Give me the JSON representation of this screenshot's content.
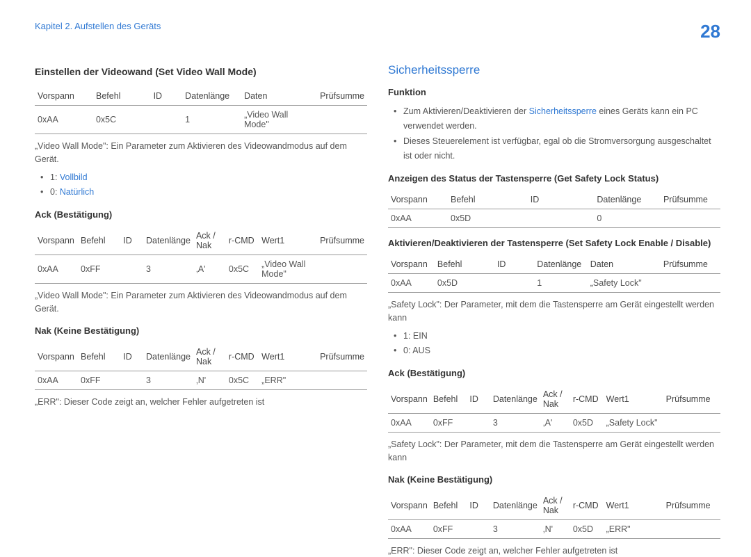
{
  "header": {
    "chapter": "Kapitel 2. Aufstellen des Geräts",
    "page_number": "28"
  },
  "left": {
    "h1": "Einstellen der Videowand (Set Video Wall Mode)",
    "table1": {
      "headers": [
        "Vorspann",
        "Befehl",
        "ID",
        "Datenlänge",
        "Daten",
        "Prüfsumme"
      ],
      "row": [
        "0xAA",
        "0x5C",
        "",
        "1",
        "„Video Wall Mode\"",
        ""
      ]
    },
    "note1": "„Video Wall Mode\": Ein Parameter zum Aktivieren des Videowandmodus auf dem Gerät.",
    "bullet1_prefix": "1: ",
    "bullet1_link": "Vollbild",
    "bullet2_prefix": "0: ",
    "bullet2_link": "Natürlich",
    "h2": "Ack (Bestätigung)",
    "table2": {
      "headers": [
        "Vorspann",
        "Befehl",
        "ID",
        "Datenlänge",
        "Ack / Nak",
        "r-CMD",
        "Wert1",
        "Prüfsumme"
      ],
      "row": [
        "0xAA",
        "0xFF",
        "",
        "3",
        "‚A'",
        "0x5C",
        "„Video Wall Mode\"",
        ""
      ]
    },
    "note2": "„Video Wall Mode\": Ein Parameter zum Aktivieren des Videowandmodus auf dem Gerät.",
    "h3": "Nak (Keine Bestätigung)",
    "table3": {
      "headers": [
        "Vorspann",
        "Befehl",
        "ID",
        "Datenlänge",
        "Ack / Nak",
        "r-CMD",
        "Wert1",
        "Prüfsumme"
      ],
      "row": [
        "0xAA",
        "0xFF",
        "",
        "3",
        "‚N'",
        "0x5C",
        "„ERR\"",
        ""
      ]
    },
    "note3": "„ERR\": Dieser Code zeigt an, welcher Fehler aufgetreten ist"
  },
  "right": {
    "main_heading": "Sicherheitssperre",
    "h1": "Funktion",
    "bullet1a": "Zum Aktivieren/Deaktivieren der ",
    "bullet1b_link": "Sicherheitssperre",
    "bullet1c": " eines Geräts kann ein PC verwendet werden.",
    "bullet2": "Dieses Steuerelement ist verfügbar, egal ob die Stromversorgung ausgeschaltet ist oder nicht.",
    "h2": "Anzeigen des Status der Tastensperre (Get Safety Lock Status)",
    "table1": {
      "headers": [
        "Vorspann",
        "Befehl",
        "ID",
        "Datenlänge",
        "Prüfsumme"
      ],
      "row": [
        "0xAA",
        "0x5D",
        "",
        "0",
        ""
      ]
    },
    "h3": "Aktivieren/Deaktivieren der Tastensperre (Set Safety Lock Enable / Disable)",
    "table2": {
      "headers": [
        "Vorspann",
        "Befehl",
        "ID",
        "Datenlänge",
        "Daten",
        "Prüfsumme"
      ],
      "row": [
        "0xAA",
        "0x5D",
        "",
        "1",
        "„Safety Lock\"",
        ""
      ]
    },
    "note1": "„Safety Lock\": Der Parameter, mit dem die Tastensperre am Gerät eingestellt werden kann",
    "bullet3": "1: EIN",
    "bullet4": "0: AUS",
    "h4": "Ack (Bestätigung)",
    "table3": {
      "headers": [
        "Vorspann",
        "Befehl",
        "ID",
        "Datenlänge",
        "Ack / Nak",
        "r-CMD",
        "Wert1",
        "Prüfsumme"
      ],
      "row": [
        "0xAA",
        "0xFF",
        "",
        "3",
        "‚A'",
        "0x5D",
        "„Safety Lock\"",
        ""
      ]
    },
    "note2": "„Safety Lock\": Der Parameter, mit dem die Tastensperre am Gerät eingestellt werden kann",
    "h5": "Nak (Keine Bestätigung)",
    "table4": {
      "headers": [
        "Vorspann",
        "Befehl",
        "ID",
        "Datenlänge",
        "Ack / Nak",
        "r-CMD",
        "Wert1",
        "Prüfsumme"
      ],
      "row": [
        "0xAA",
        "0xFF",
        "",
        "3",
        "‚N'",
        "0x5D",
        "„ERR\"",
        ""
      ]
    },
    "note3": "„ERR\": Dieser Code zeigt an, welcher Fehler aufgetreten ist"
  }
}
